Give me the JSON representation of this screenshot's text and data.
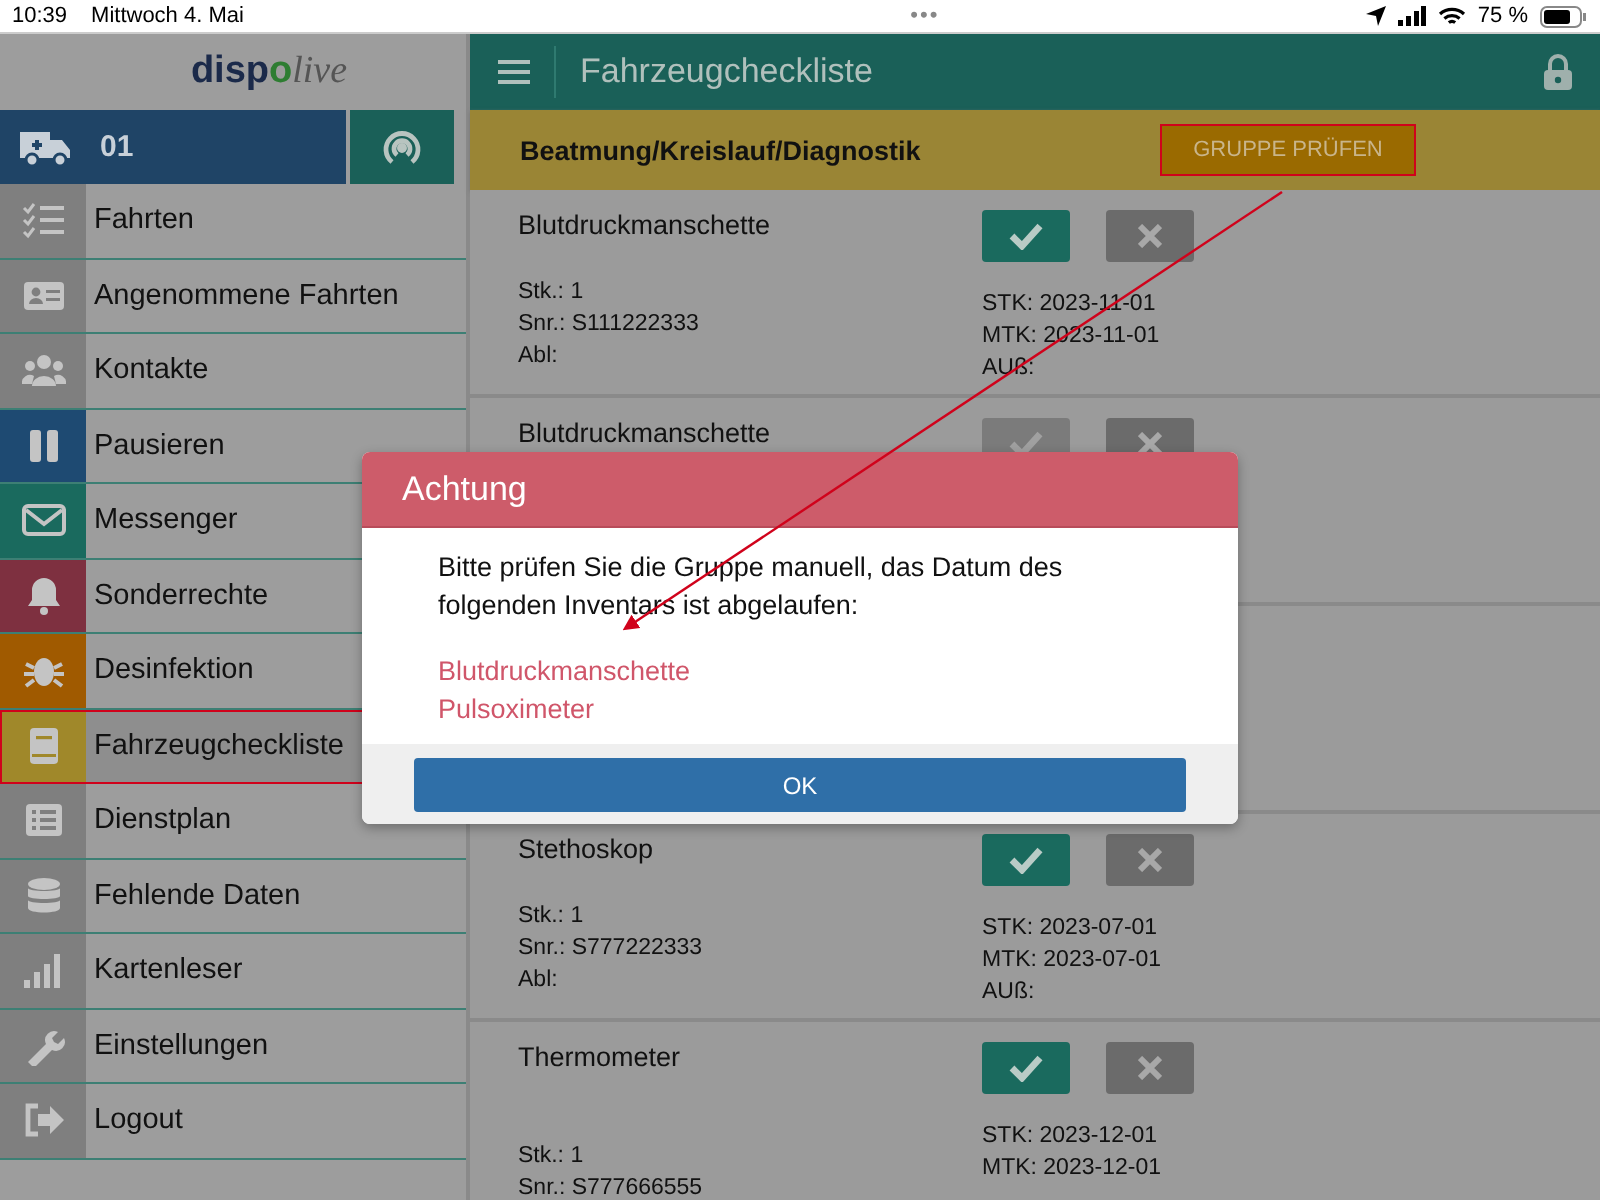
{
  "status_bar": {
    "time": "10:39",
    "date": "Mittwoch 4. Mai",
    "dots": "•••",
    "battery_text": "75 %"
  },
  "sidebar": {
    "logo": [
      {
        "text": "disp",
        "kind": "strong"
      },
      {
        "text": "o",
        "kind": "accent"
      },
      {
        "text": "live",
        "kind": "light"
      }
    ],
    "vehicle": "01",
    "items": [
      {
        "label": "Fahrten",
        "color": "#7f7f7f",
        "selected": false,
        "highlighted": false
      },
      {
        "label": "Angenommene Fahrten",
        "color": "#7f7f7f",
        "selected": false,
        "highlighted": false
      },
      {
        "label": "Kontakte",
        "color": "#7f7f7f",
        "selected": false,
        "highlighted": false
      },
      {
        "label": "Pausieren",
        "color": "#1e4a72",
        "selected": false,
        "highlighted": false
      },
      {
        "label": "Messenger",
        "color": "#1a6a5e",
        "selected": false,
        "highlighted": false
      },
      {
        "label": "Sonderrechte",
        "color": "#7e3040",
        "selected": false,
        "highlighted": false
      },
      {
        "label": "Desinfektion",
        "color": "#a05a00",
        "selected": false,
        "highlighted": false
      },
      {
        "label": "Fahrzeugcheckliste",
        "color": "#a0882a",
        "selected": true,
        "highlighted": true
      },
      {
        "label": "Dienstplan",
        "color": "#7f7f7f",
        "selected": false,
        "highlighted": false
      },
      {
        "label": "Fehlende Daten",
        "color": "#7f7f7f",
        "selected": false,
        "highlighted": false
      },
      {
        "label": "Kartenleser",
        "color": "#7f7f7f",
        "selected": false,
        "highlighted": false
      },
      {
        "label": "Einstellungen",
        "color": "#7f7f7f",
        "selected": false,
        "highlighted": false
      },
      {
        "label": "Logout",
        "color": "#7f7f7f",
        "selected": false,
        "highlighted": false
      }
    ]
  },
  "header": {
    "title": "Fahrzeugcheckliste"
  },
  "group": {
    "title": "Beatmung/Kreislauf/Diagnostik",
    "button": "GRUPPE PRÜFEN",
    "highlighted": true
  },
  "rows": [
    {
      "name": "Blutdruckmanschette",
      "confirmed": true,
      "left": [
        "Stk.: 1",
        "Snr.: S111222333",
        "Abl:"
      ],
      "right": [
        "STK: 2023-11-01",
        "MTK: 2023-11-01",
        "AUß:"
      ]
    },
    {
      "name": "Blutdruckmanschette",
      "confirmed": false,
      "left": [],
      "right": []
    },
    {
      "name": "Stethoskop",
      "confirmed": true,
      "left": [
        "Stk.: 1",
        "Snr.: S777222333",
        "Abl:"
      ],
      "right": [
        "STK: 2023-07-01",
        "MTK: 2023-07-01",
        "AUß:"
      ]
    },
    {
      "name": "Thermometer",
      "confirmed": true,
      "left": [
        "Stk.: 1",
        "Snr.: S777666555"
      ],
      "right": [
        "STK: 2023-12-01",
        "MTK: 2023-12-01"
      ]
    }
  ],
  "dialog": {
    "title": "Achtung",
    "message": "Bitte prüfen Sie die Gruppe manuell, das Datum des folgenden Inventars ist abgelaufen:",
    "items": [
      "Blutdruckmanschette",
      "Pulsoximeter"
    ],
    "button": "OK"
  }
}
